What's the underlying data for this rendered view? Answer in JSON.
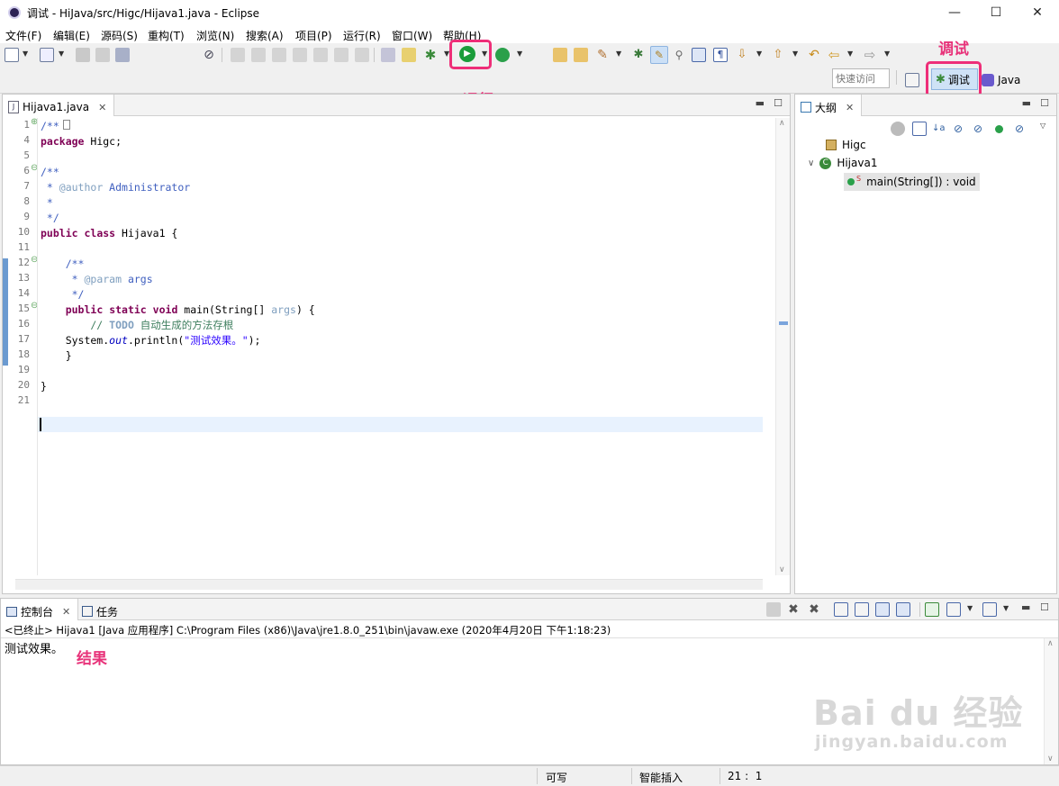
{
  "window": {
    "title": "调试 - HiJava/src/Higc/Hijava1.java - Eclipse",
    "controls": {
      "minimize": "—",
      "maximize": "☐",
      "close": "✕"
    }
  },
  "menubar": [
    "文件(F)",
    "编辑(E)",
    "源码(S)",
    "重构(T)",
    "浏览(N)",
    "搜索(A)",
    "项目(P)",
    "运行(R)",
    "窗口(W)",
    "帮助(H)"
  ],
  "toolbar": {
    "quick_access_placeholder": "快速访问",
    "perspectives": [
      {
        "label": "调试",
        "active": true
      },
      {
        "label": "Java",
        "active": false
      }
    ]
  },
  "editor": {
    "tab_label": "Hijava1.java",
    "line_numbers": [
      "1",
      "4",
      "5",
      "6",
      "7",
      "8",
      "9",
      "10",
      "11",
      "12",
      "13",
      "14",
      "15",
      "16",
      "17",
      "18",
      "19",
      "20",
      "21"
    ],
    "lines": [
      [
        {
          "t": "/**",
          "c": "cm"
        }
      ],
      [
        {
          "t": "package",
          "c": "kw"
        },
        {
          "t": " Higc;"
        }
      ],
      [],
      [
        {
          "t": "/**",
          "c": "cm"
        }
      ],
      [
        {
          "t": " * ",
          "c": "cm"
        },
        {
          "t": "@author",
          "c": "param"
        },
        {
          "t": " Administrator",
          "c": "cm"
        }
      ],
      [
        {
          "t": " *",
          "c": "cm"
        }
      ],
      [
        {
          "t": " */",
          "c": "cm"
        }
      ],
      [
        {
          "t": "public",
          "c": "kw"
        },
        {
          "t": " "
        },
        {
          "t": "class",
          "c": "kw"
        },
        {
          "t": " Hijava1 {"
        }
      ],
      [],
      [
        {
          "t": "    /**",
          "c": "cm"
        }
      ],
      [
        {
          "t": "     * ",
          "c": "cm"
        },
        {
          "t": "@param",
          "c": "param"
        },
        {
          "t": " args",
          "c": "cm"
        }
      ],
      [
        {
          "t": "     */",
          "c": "cm"
        }
      ],
      [
        {
          "t": "    "
        },
        {
          "t": "public",
          "c": "kw"
        },
        {
          "t": " "
        },
        {
          "t": "static",
          "c": "kw"
        },
        {
          "t": " "
        },
        {
          "t": "void",
          "c": "kw"
        },
        {
          "t": " main(String[] "
        },
        {
          "t": "args",
          "c": "param"
        },
        {
          "t": ") {"
        }
      ],
      [
        {
          "t": "        // ",
          "c": "cm2"
        },
        {
          "t": "TODO",
          "c": "todo"
        },
        {
          "t": " 自动生成的方法存根",
          "c": "cm2"
        }
      ],
      [
        {
          "t": "    System."
        },
        {
          "t": "out",
          "c": "fld"
        },
        {
          "t": ".println("
        },
        {
          "t": "\"测试效果。\"",
          "c": "str"
        },
        {
          "t": ");"
        }
      ],
      [
        {
          "t": "    }"
        }
      ],
      [],
      [
        {
          "t": "}"
        }
      ],
      []
    ]
  },
  "outline": {
    "tab_label": "大纲",
    "items": [
      {
        "label": "Higc",
        "kind": "package"
      },
      {
        "label": "Hijava1",
        "kind": "class"
      },
      {
        "label": "main(String[]) : void",
        "kind": "method"
      }
    ]
  },
  "console": {
    "tabs": [
      "控制台",
      "任务"
    ],
    "header": "<已终止> Hijava1 [Java 应用程序] C:\\Program Files (x86)\\Java\\jre1.8.0_251\\bin\\javaw.exe  (2020年4月20日 下午1:18:23)",
    "output": "测试效果。"
  },
  "statusbar": {
    "writable": "可写",
    "insert_mode": "智能插入",
    "position": "21 :  1"
  },
  "annotations": {
    "run": "运行",
    "debug": "调试",
    "result": "结果"
  },
  "watermark": {
    "brand": "Bai  du 经验",
    "url": "jingyan.baidu.com"
  },
  "colors": {
    "annotation": "#ee2e78",
    "keyword": "#7f0055",
    "comment": "#3f5fbf",
    "string": "#2a00ff",
    "run_green": "#1a9c3a"
  }
}
